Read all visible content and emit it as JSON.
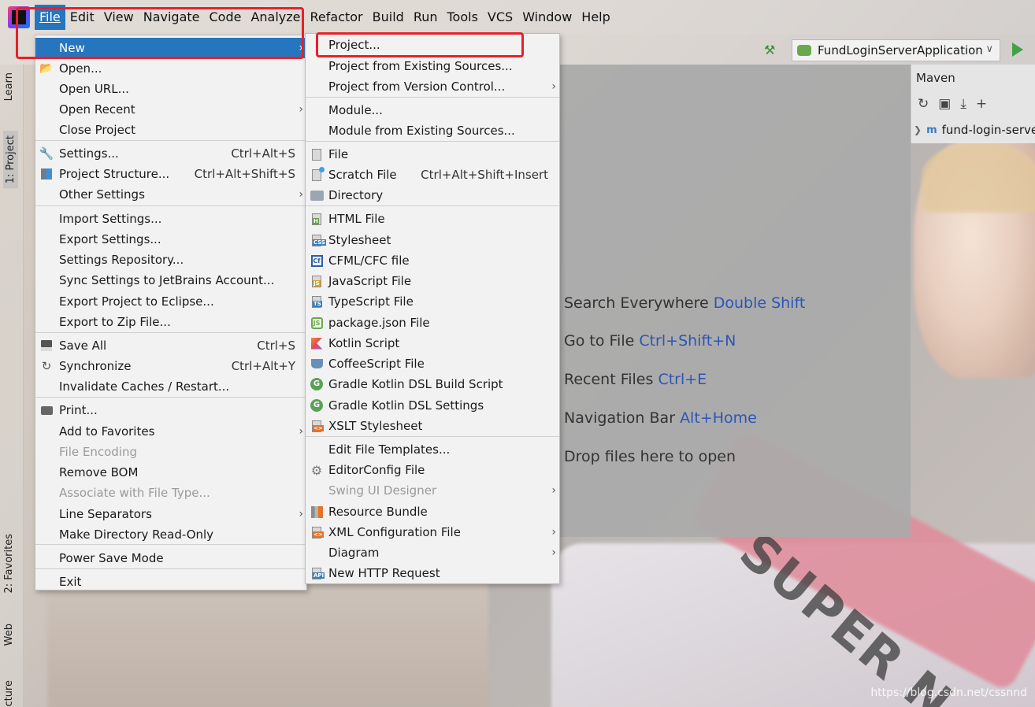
{
  "menubar": {
    "items": [
      "File",
      "Edit",
      "View",
      "Navigate",
      "Code",
      "Analyze",
      "Refactor",
      "Build",
      "Run",
      "Tools",
      "VCS",
      "Window",
      "Help"
    ]
  },
  "toolbar": {
    "run_config": "FundLoginServerApplication"
  },
  "left_strip": {
    "learn": "Learn",
    "project": "1: Project",
    "favorites": "2: Favorites",
    "web": "Web",
    "structure": "Structure"
  },
  "maven": {
    "title": "Maven",
    "tree_root": "fund-login-server"
  },
  "editor_hints": [
    {
      "text": "Search Everywhere",
      "key": "Double Shift"
    },
    {
      "text": "Go to File",
      "key": "Ctrl+Shift+N"
    },
    {
      "text": "Recent Files",
      "key": "Ctrl+E"
    },
    {
      "text": "Navigation Bar",
      "key": "Alt+Home"
    },
    {
      "text": "Drop files here to open",
      "key": ""
    }
  ],
  "file_menu": [
    {
      "label": "New",
      "sel": true,
      "arrow": true
    },
    {
      "label": "Open...",
      "icon": "folder-icon"
    },
    {
      "label": "Open URL..."
    },
    {
      "label": "Open Recent",
      "arrow": true
    },
    {
      "label": "Close Project"
    },
    {
      "label": "Settings...",
      "icon": "wrench-icon",
      "shortcut": "Ctrl+Alt+S"
    },
    {
      "label": "Project Structure...",
      "icon": "project-structure-icon",
      "shortcut": "Ctrl+Alt+Shift+S"
    },
    {
      "label": "Other Settings",
      "arrow": true
    },
    {
      "label": "Import Settings..."
    },
    {
      "label": "Export Settings..."
    },
    {
      "label": "Settings Repository..."
    },
    {
      "label": "Sync Settings to JetBrains Account..."
    },
    {
      "label": "Export Project to Eclipse..."
    },
    {
      "label": "Export to Zip File..."
    },
    {
      "label": "Save All",
      "icon": "save-icon",
      "shortcut": "Ctrl+S"
    },
    {
      "label": "Synchronize",
      "icon": "sync-icon",
      "shortcut": "Ctrl+Alt+Y"
    },
    {
      "label": "Invalidate Caches / Restart..."
    },
    {
      "label": "Print...",
      "icon": "print-icon"
    },
    {
      "label": "Add to Favorites",
      "arrow": true
    },
    {
      "label": "File Encoding",
      "disabled": true
    },
    {
      "label": "Remove BOM"
    },
    {
      "label": "Associate with File Type...",
      "disabled": true
    },
    {
      "label": "Line Separators",
      "arrow": true
    },
    {
      "label": "Make Directory Read-Only"
    },
    {
      "label": "Power Save Mode"
    },
    {
      "label": "Exit"
    }
  ],
  "new_menu": [
    {
      "label": "Project..."
    },
    {
      "label": "Project from Existing Sources..."
    },
    {
      "label": "Project from Version Control...",
      "arrow": true
    },
    {
      "label": "Module..."
    },
    {
      "label": "Module from Existing Sources..."
    },
    {
      "label": "File",
      "icon": "file-icon"
    },
    {
      "label": "Scratch File",
      "icon": "scratch-file-icon",
      "shortcut": "Ctrl+Alt+Shift+Insert"
    },
    {
      "label": "Directory",
      "icon": "directory-icon"
    },
    {
      "label": "HTML File",
      "icon": "html-file-icon"
    },
    {
      "label": "Stylesheet",
      "icon": "css-file-icon"
    },
    {
      "label": "CFML/CFC file",
      "icon": "cfml-file-icon"
    },
    {
      "label": "JavaScript File",
      "icon": "javascript-file-icon"
    },
    {
      "label": "TypeScript File",
      "icon": "typescript-file-icon"
    },
    {
      "label": "package.json File",
      "icon": "nodejs-icon"
    },
    {
      "label": "Kotlin Script",
      "icon": "kotlin-icon"
    },
    {
      "label": "CoffeeScript File",
      "icon": "coffeescript-icon"
    },
    {
      "label": "Gradle Kotlin DSL Build Script",
      "icon": "gradle-icon"
    },
    {
      "label": "Gradle Kotlin DSL Settings",
      "icon": "gradle-icon"
    },
    {
      "label": "XSLT Stylesheet",
      "icon": "xslt-icon"
    },
    {
      "label": "Edit File Templates..."
    },
    {
      "label": "EditorConfig File",
      "icon": "gear-icon"
    },
    {
      "label": "Swing UI Designer",
      "disabled": true,
      "arrow": true
    },
    {
      "label": "Resource Bundle",
      "icon": "resource-bundle-icon"
    },
    {
      "label": "XML Configuration File",
      "icon": "xml-icon",
      "arrow": true
    },
    {
      "label": "Diagram",
      "arrow": true
    },
    {
      "label": "New HTTP Request",
      "icon": "api-icon"
    }
  ],
  "watermark": "https://blog.csdn.net/cssnnd"
}
